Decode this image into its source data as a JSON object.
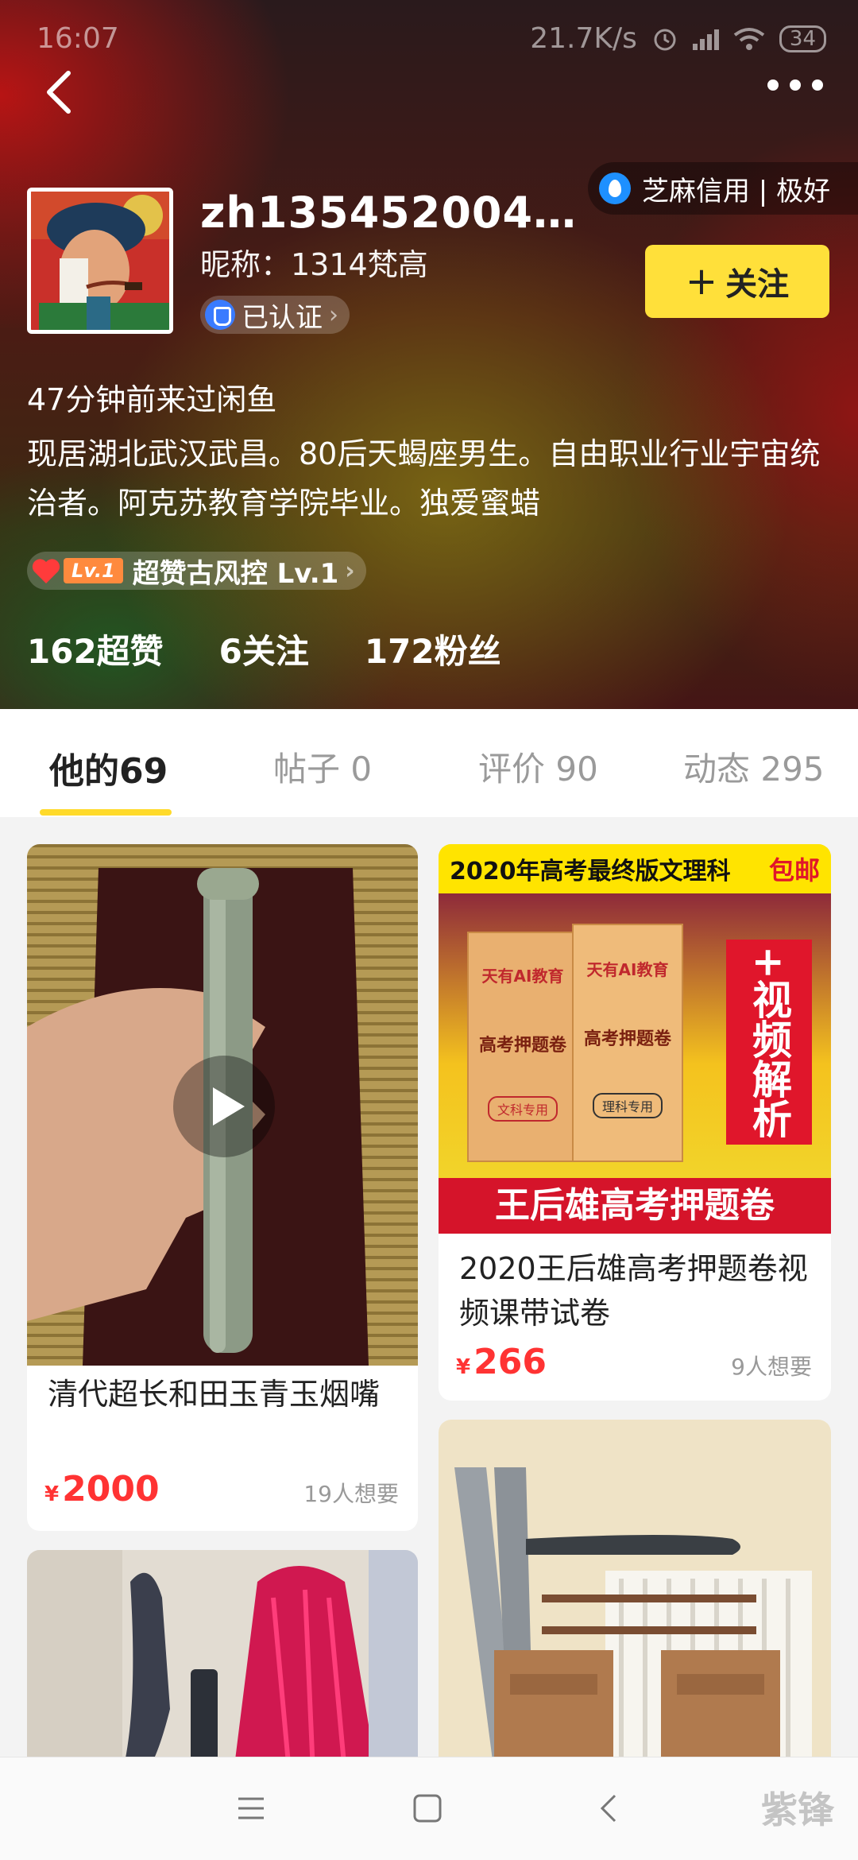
{
  "status_bar": {
    "time": "16:07",
    "net_speed": "21.7K/s",
    "battery": "34"
  },
  "header": {
    "credit_badge": "芝麻信用 | 极好",
    "username": "zh135452004…",
    "nickname": "昵称：1314梵高",
    "verified_label": "已认证",
    "follow_label": "关注",
    "last_seen": "47分钟前来过闲鱼",
    "bio": "现居湖北武汉武昌。80后天蝎座男生。自由职业行业宇宙统治者。阿克苏教育学院毕业。独爱蜜蜡",
    "level_tag": "Lv.1",
    "level_label": "超赞古风控 Lv.1",
    "stats": {
      "likes": "162超赞",
      "following": "6关注",
      "fans": "172粉丝"
    }
  },
  "tabs": [
    {
      "label": "他的69"
    },
    {
      "label": "帖子 0"
    },
    {
      "label": "评价 90"
    },
    {
      "label": "动态 295"
    }
  ],
  "cards": [
    {
      "title": "清代超长和田玉青玉烟嘴",
      "price_symbol": "¥",
      "price": "2000",
      "wants": "19人想要"
    },
    {
      "title": "2020王后雄高考押题卷视频课带试卷",
      "price_symbol": "¥",
      "price": "266",
      "wants": "9人想要",
      "banner_top": "2020年高考最终版文理科",
      "banner_tag": "包邮",
      "side_text": "+视频解析",
      "banner_bottom": "王后雄高考押题卷",
      "book_title": "天有AI教育",
      "book_subtitle": "高考押题卷",
      "book_left": "文科专用",
      "book_right": "理科专用"
    }
  ],
  "colors": {
    "accent_yellow": "#ffe03a",
    "price_red": "#ff3333",
    "tab_underline": "#ffda2a"
  },
  "watermark": "紫锋"
}
